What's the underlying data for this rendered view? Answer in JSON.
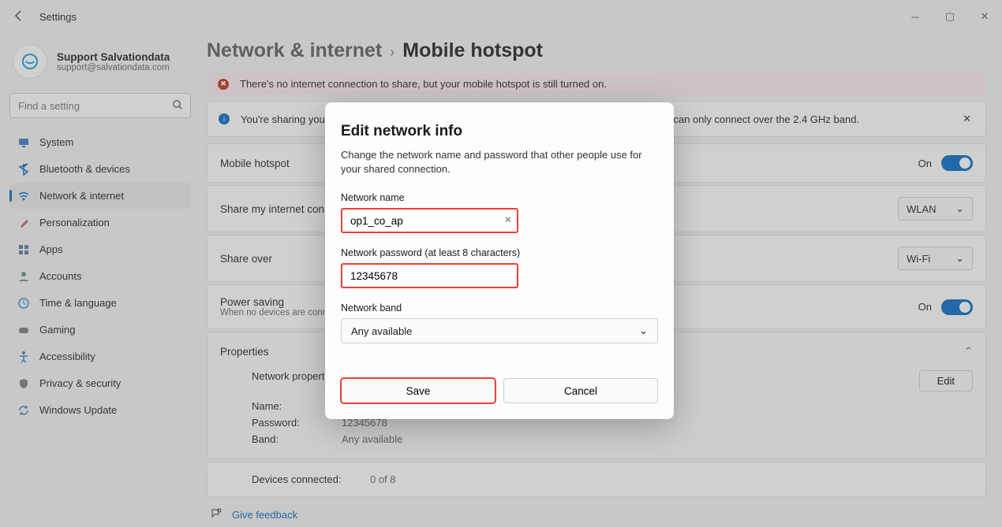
{
  "window": {
    "title": "Settings"
  },
  "profile": {
    "name": "Support Salvationdata",
    "email": "support@salvationdata.com"
  },
  "search": {
    "placeholder": "Find a setting"
  },
  "nav": [
    {
      "icon": "monitor",
      "label": "System",
      "color": "#3a78c4"
    },
    {
      "icon": "bluetooth",
      "label": "Bluetooth & devices",
      "color": "#3a78c4"
    },
    {
      "icon": "wifi",
      "label": "Network & internet",
      "color": "#3a78c4",
      "active": true
    },
    {
      "icon": "brush",
      "label": "Personalization",
      "color": "#d06050"
    },
    {
      "icon": "grid",
      "label": "Apps",
      "color": "#5a78a4"
    },
    {
      "icon": "user",
      "label": "Accounts",
      "color": "#6a8a84"
    },
    {
      "icon": "clock",
      "label": "Time & language",
      "color": "#3a78c4"
    },
    {
      "icon": "game",
      "label": "Gaming",
      "color": "#7a7a7a"
    },
    {
      "icon": "access",
      "label": "Accessibility",
      "color": "#3a78c4"
    },
    {
      "icon": "shield",
      "label": "Privacy & security",
      "color": "#7a7a7a"
    },
    {
      "icon": "sync",
      "label": "Windows Update",
      "color": "#3a78c4"
    }
  ],
  "breadcrumb": {
    "parent": "Network & internet",
    "current": "Mobile hotspot"
  },
  "banners": {
    "error": "There's no internet connection to share, but your mobile hotspot is still turned on.",
    "info_pre": "You're sharing your c",
    "info_post": "t can only connect over the 2.4 GHz band."
  },
  "settings": {
    "mobile_hotspot_label": "Mobile hotspot",
    "mobile_hotspot_state": "On",
    "share_from_label": "Share my internet connect",
    "share_from_value": "WLAN",
    "share_over_label": "Share over",
    "share_over_value": "Wi-Fi",
    "power_label": "Power saving",
    "power_sub": "When no devices are connect",
    "power_state": "On"
  },
  "properties": {
    "header": "Properties",
    "section_title": "Network properties",
    "edit_label": "Edit",
    "name_k": "Name:",
    "password_k": "Password:",
    "password_v": "12345678",
    "band_k": "Band:",
    "band_v": "Any available",
    "devices_k": "Devices connected:",
    "devices_v": "0 of 8"
  },
  "feedback": "Give feedback",
  "dialog": {
    "title": "Edit network info",
    "desc": "Change the network name and password that other people use for your shared connection.",
    "name_label": "Network name",
    "name_value": "op1_co_ap",
    "pwd_label": "Network password (at least 8 characters)",
    "pwd_value": "12345678",
    "band_label": "Network band",
    "band_value": "Any available",
    "save": "Save",
    "cancel": "Cancel"
  }
}
